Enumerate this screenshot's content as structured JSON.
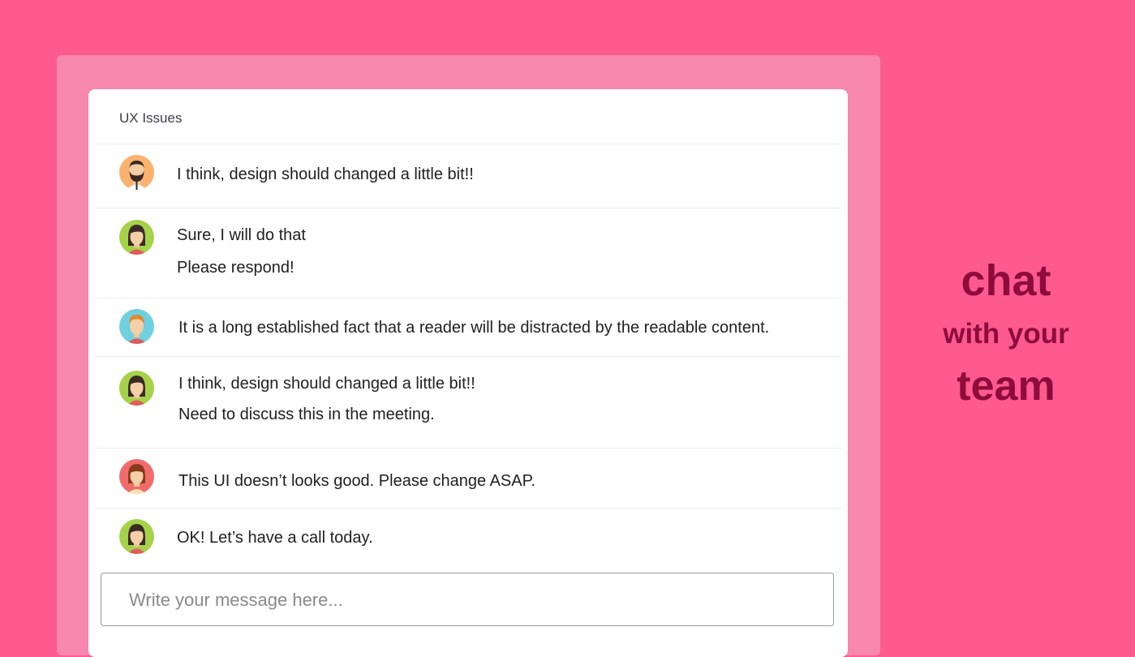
{
  "channel": {
    "title": "UX Issues"
  },
  "messages": [
    {
      "avatar": "bearded-man-avatar-icon",
      "avatar_bg": "#fbb26e",
      "lines": [
        "I think, design should changed a little bit!!"
      ]
    },
    {
      "avatar": "woman-avatar-icon",
      "avatar_bg": "#a6d24a",
      "lines": [
        "Sure, I will do that",
        "Please respond!"
      ]
    },
    {
      "avatar": "man-avatar-icon",
      "avatar_bg": "#6fd0df",
      "lines": [
        "It is a long established fact that a reader will be distracted by the readable content."
      ]
    },
    {
      "avatar": "woman-avatar-icon",
      "avatar_bg": "#a6d24a",
      "lines": [
        "I think, design should changed a little bit!!",
        "Need to discuss this in the meeting."
      ]
    },
    {
      "avatar": "woman-avatar-icon",
      "avatar_bg": "#f26b6b",
      "lines": [
        "This UI doesn’t looks good. Please change ASAP."
      ]
    },
    {
      "avatar": "woman-avatar-icon",
      "avatar_bg": "#a6d24a",
      "lines": [
        "OK! Let’s have a call today."
      ]
    }
  ],
  "composer": {
    "placeholder": "Write your message here..."
  },
  "tagline": {
    "line1": "chat",
    "line2": "with your",
    "line3": "team"
  },
  "colors": {
    "background": "#fe5a8f",
    "frame": "#f787ad",
    "tagline": "#8e0c3b"
  }
}
